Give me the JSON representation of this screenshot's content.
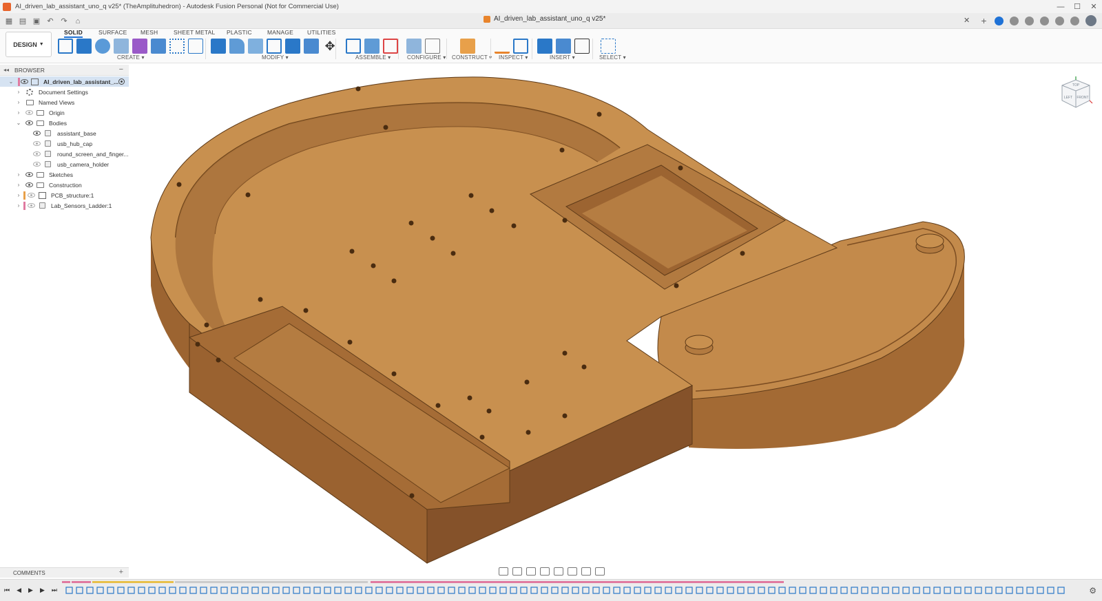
{
  "window": {
    "title": "AI_driven_lab_assistant_uno_q v25* (TheAmplituhedron) - Autodesk Fusion Personal (Not for Commercial Use)",
    "minimize": "—",
    "maximize": "☐",
    "close": "✕"
  },
  "tabbar": {
    "document_tab": "AI_driven_lab_assistant_uno_q v25*",
    "close_glyph": "✕",
    "new_tab_glyph": "+"
  },
  "toolbar": {
    "workspace": "DESIGN",
    "tabs": [
      "SOLID",
      "SURFACE",
      "MESH",
      "SHEET METAL",
      "PLASTIC",
      "MANAGE",
      "UTILITIES"
    ],
    "active_tab": "SOLID",
    "groups": [
      "CREATE",
      "MODIFY",
      "ASSEMBLE",
      "CONFIGURE",
      "CONSTRUCT",
      "INSPECT",
      "INSERT",
      "SELECT"
    ]
  },
  "browser": {
    "header": "BROWSER",
    "root": "AI_driven_lab_assistant_...",
    "items": [
      {
        "label": "Document Settings"
      },
      {
        "label": "Named Views"
      },
      {
        "label": "Origin"
      },
      {
        "label": "Bodies"
      },
      {
        "label": "assistant_base"
      },
      {
        "label": "usb_hub_cap"
      },
      {
        "label": "round_screen_and_finger..."
      },
      {
        "label": "usb_camera_holder"
      },
      {
        "label": "Sketches"
      },
      {
        "label": "Construction"
      },
      {
        "label": "PCB_structure:1"
      },
      {
        "label": "Lab_Sensors_Ladder:1"
      }
    ]
  },
  "comments": {
    "label": "COMMENTS"
  },
  "viewcube": {
    "front": "FRONT",
    "left": "LEFT",
    "top": "TOP"
  },
  "colors": {
    "accent": "#1f72d6",
    "model_top": "#c8904f",
    "model_side": "#a36a34",
    "model_dark": "#8a5527",
    "pink_flag": "#e07aa0",
    "orange_flag": "#e8a04a"
  }
}
